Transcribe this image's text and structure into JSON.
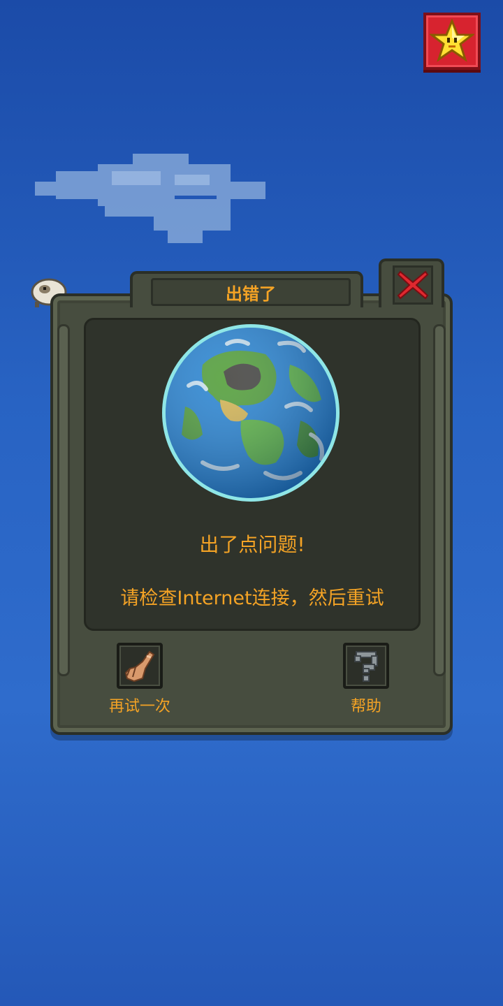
{
  "dialog": {
    "title": "出错了",
    "message_title": "出了点问题!",
    "message_body": "请检查Internet连接，然后重试"
  },
  "actions": {
    "retry_label": "再试一次",
    "help_label": "帮助"
  },
  "colors": {
    "background": "#2863c3",
    "dialog_frame": "#474d3f",
    "text_accent": "#f4a325",
    "close_red": "#e0282f"
  },
  "icons": {
    "top_right": "star-icon",
    "close": "close-icon",
    "retry": "pointing-hand-icon",
    "help": "question-mark-icon",
    "globe": "globe-icon",
    "cloud": "cloud-icon",
    "sheep": "sheep-icon"
  }
}
